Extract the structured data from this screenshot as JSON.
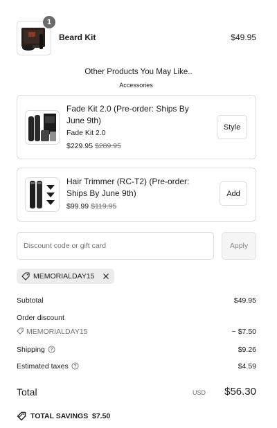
{
  "cart": {
    "item": {
      "title": "Beard Kit",
      "price": "$49.95",
      "quantity": "1"
    }
  },
  "upsell": {
    "heading": "Other Products You May Like..",
    "subheading": "Accessories",
    "products": [
      {
        "title": "Fade Kit 2.0 (Pre-order: Ships By June 9th)",
        "variant": "Fade Kit 2.0",
        "price": "$229.95",
        "compare_price": "$289.95",
        "button": "Style"
      },
      {
        "title": "Hair Trimmer (RC-T2) (Pre-order: Ships By June 9th)",
        "price": "$99.99",
        "compare_price": "$119.95",
        "button": "Add"
      }
    ]
  },
  "discount": {
    "placeholder": "Discount code or gift card",
    "apply_label": "Apply",
    "applied_code": "MEMORIALDAY15"
  },
  "summary": {
    "subtotal_label": "Subtotal",
    "subtotal_value": "$49.95",
    "order_discount_label": "Order discount",
    "discount_code": "MEMORIALDAY15",
    "discount_value": "− $7.50",
    "shipping_label": "Shipping",
    "shipping_value": "$9.26",
    "taxes_label": "Estimated taxes",
    "taxes_value": "$4.59",
    "total_label": "Total",
    "currency": "USD",
    "total_value": "$56.30",
    "savings_label": "TOTAL SAVINGS",
    "savings_value": "$7.50"
  },
  "icons": {
    "tag": "tag-icon",
    "close": "close-icon",
    "info": "info-icon",
    "savings": "savings-tag-icon"
  },
  "colors": {
    "text": "#1a1a1a",
    "muted": "#707070",
    "border": "#dcdcdc",
    "badge": "#6b6b6b",
    "tag_bg": "#ececec"
  }
}
